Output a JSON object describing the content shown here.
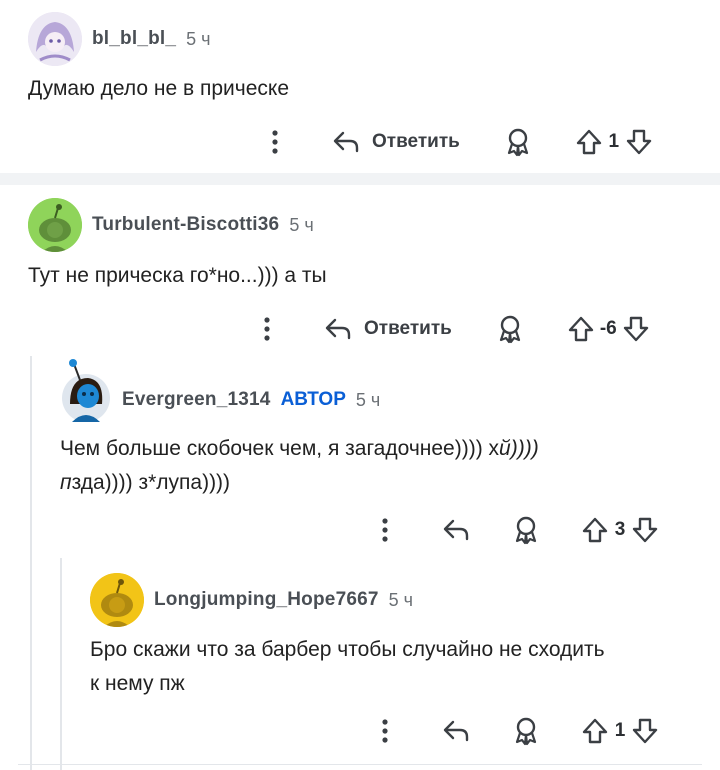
{
  "comments": [
    {
      "username": "bl_bl_bl_",
      "time": "5 ч",
      "text": "Думаю дело не в прическе",
      "reply_label": "Ответить",
      "score": "1",
      "avatar_color": "#b7a7d8"
    },
    {
      "username": "Turbulent-Biscotti36",
      "time": "5 ч",
      "text": "Тут не прическа го*но...))) а ты",
      "reply_label": "Ответить",
      "score": "-6",
      "avatar_color": "#8fd45a"
    },
    {
      "username": "Evergreen_1314",
      "badge": "АВТОР",
      "time": "5 ч",
      "text_line1_a": "Чем больше скобочек чем, я загадочнее)))) х",
      "text_line1_b": "й))))",
      "text_line2_a": "п",
      "text_line2_b": "зда)))) з*лупа))))",
      "score": "3",
      "avatar_color": "#1e88d4"
    },
    {
      "username": "Longjumping_Hope7667",
      "time": "5 ч",
      "text_line1": "Бро скажи что за барбер чтобы случайно не сходить",
      "text_line2": "к нему пж",
      "score": "1",
      "avatar_color": "#f2c417"
    }
  ],
  "icons": {
    "more": "more-vertical-icon",
    "reply": "reply-arrow-icon",
    "award": "award-icon",
    "upvote": "upvote-arrow-icon",
    "downvote": "downvote-arrow-icon"
  },
  "colors": {
    "badge": "#0a5fd6",
    "divider": "#f1f3f5",
    "thread_line": "#e3e6ea"
  }
}
